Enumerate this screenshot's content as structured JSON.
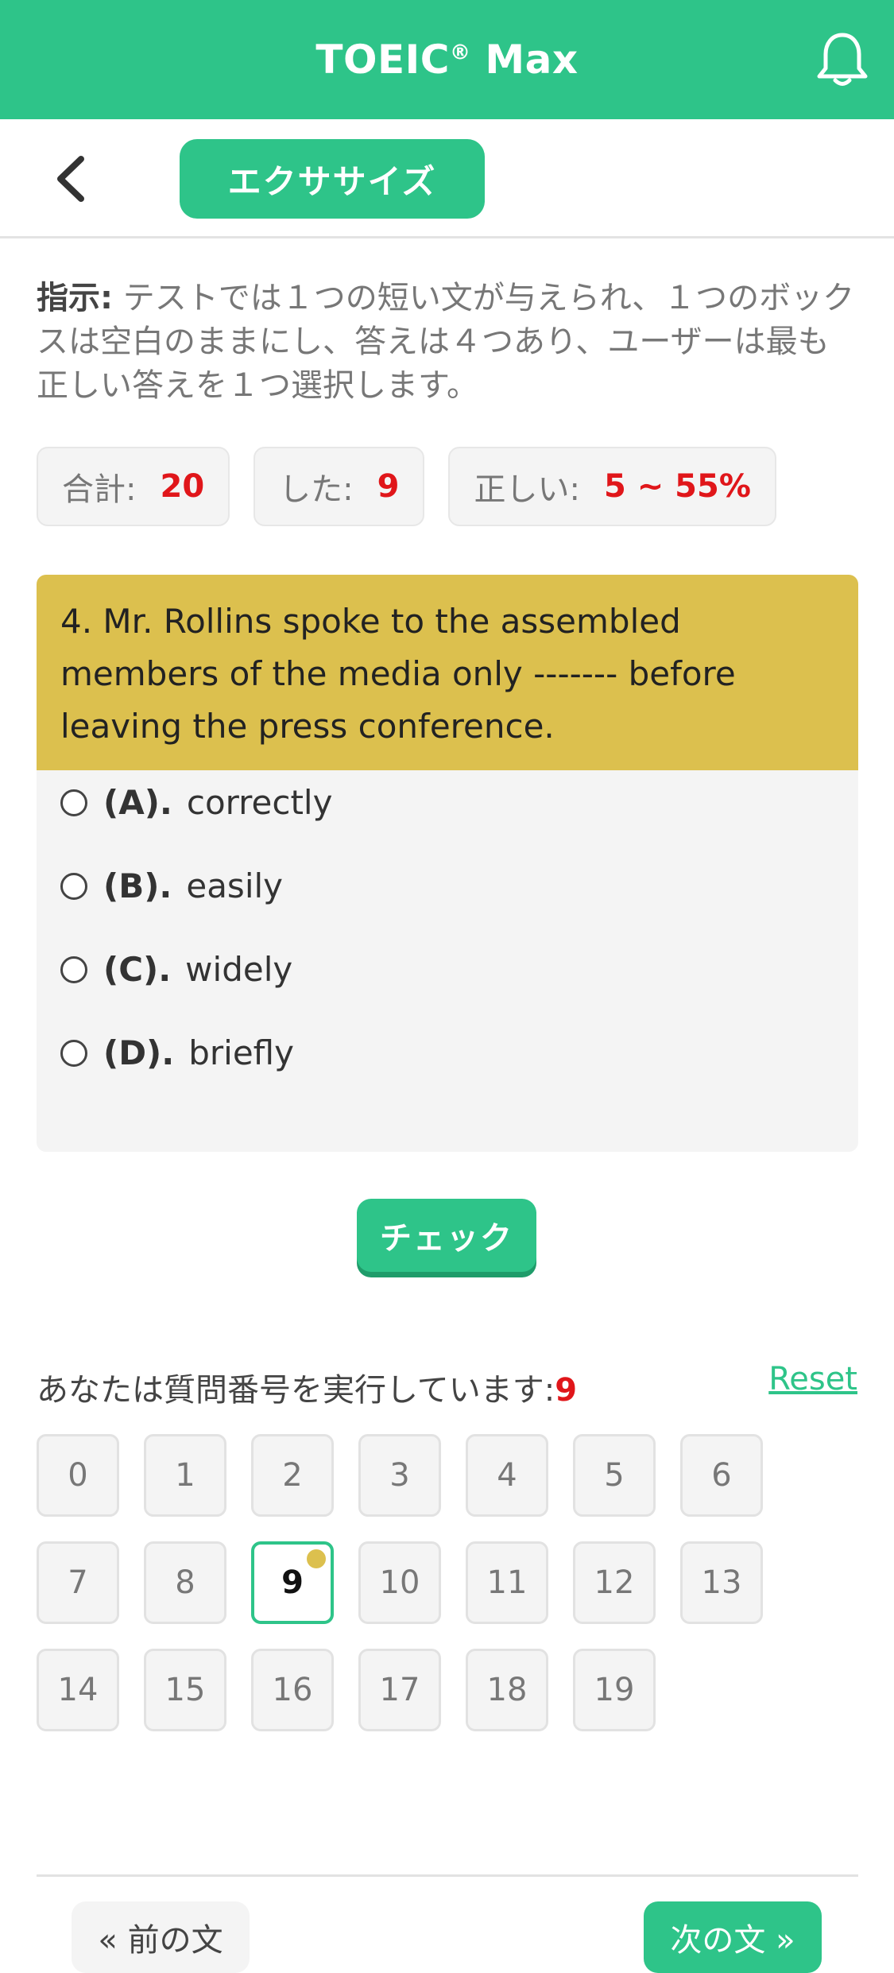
{
  "app": {
    "title": "TOEIC",
    "title_mark": "®",
    "title_suffix": " Max"
  },
  "header": {
    "section_label": "エクササイズ"
  },
  "instructions": {
    "label": "指示:",
    "text": " テストでは１つの短い文が与えられ、１つのボックスは空白のままにし、答えは４つあり、ユーザーは最も正しい答えを１つ選択します。"
  },
  "stats": [
    {
      "label": "合計:",
      "value": "20"
    },
    {
      "label": "した:",
      "value": "9"
    },
    {
      "label": "正しい:",
      "value": "5 ~ 55%"
    }
  ],
  "question": {
    "text": "4. Mr. Rollins spoke to the assembled members of the media only ------- before leaving the press conference.",
    "options": [
      {
        "label": "(A).",
        "text": "correctly"
      },
      {
        "label": "(B).",
        "text": "easily"
      },
      {
        "label": "(C).",
        "text": "widely"
      },
      {
        "label": "(D).",
        "text": "briefly"
      }
    ]
  },
  "check_label": "チェック",
  "progress": {
    "label": "あなたは質問番号を実行しています:",
    "current": "9",
    "reset_label": "Reset",
    "numbers": [
      "0",
      "1",
      "2",
      "3",
      "4",
      "5",
      "6",
      "7",
      "8",
      "9",
      "10",
      "11",
      "12",
      "13",
      "14",
      "15",
      "16",
      "17",
      "18",
      "19"
    ]
  },
  "nav": {
    "prev_label": "« 前の文",
    "next_label": "次の文 »"
  },
  "colors": {
    "accent": "#2ec489",
    "highlight": "#dcc04e",
    "error": "#e0161a"
  },
  "icons": {
    "bell": "bell-icon",
    "back": "chevron-left-icon"
  }
}
